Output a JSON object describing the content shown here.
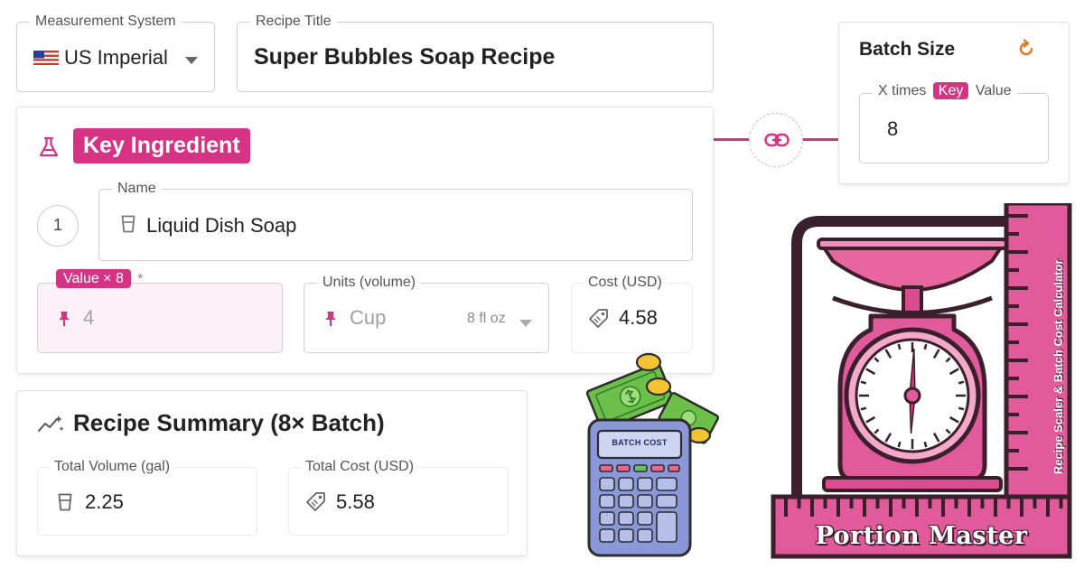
{
  "colors": {
    "accent": "#d63384",
    "accent_light": "#fdf0f6",
    "border": "#cfcfcf",
    "text": "#222222",
    "muted": "#999999",
    "brand_dark": "#3b1f2b",
    "calc_blue": "#8a97d8"
  },
  "measurement_system": {
    "label": "Measurement System",
    "value": "US Imperial",
    "flag_icon": "us-flag-icon"
  },
  "recipe_title": {
    "label": "Recipe Title",
    "value": "Super Bubbles Soap Recipe"
  },
  "batch_size": {
    "title": "Batch Size",
    "reset_icon": "reset-icon",
    "field_label_prefix": "X times",
    "field_label_chip": "Key",
    "field_label_suffix": "Value",
    "value": "8"
  },
  "key_ingredient": {
    "icon": "flask-icon",
    "title": "Key Ingredient",
    "step_number": "1",
    "name_label": "Name",
    "name_value": "Liquid Dish Soap",
    "value_label": "Value × 8",
    "value_required": "*",
    "value_placeholder": "4",
    "units_label": "Units (volume)",
    "units_value": "Cup",
    "units_hint": "8 fl oz",
    "cost_label": "Cost (USD)",
    "cost_value": "4.58"
  },
  "link_icon": "link-icon",
  "summary": {
    "icon": "sparkle-chart-icon",
    "title": "Recipe Summary (8× Batch)",
    "volume_label": "Total Volume (gal)",
    "volume_value": "2.25",
    "cost_label": "Total Cost (USD)",
    "cost_value": "5.58"
  },
  "illustration": {
    "calculator_label": "BATCH COST",
    "brand_name": "Portion Master",
    "ruler_tagline": "Recipe Scaler & Batch Cost Calculator",
    "scale_ratio": 0.35
  }
}
